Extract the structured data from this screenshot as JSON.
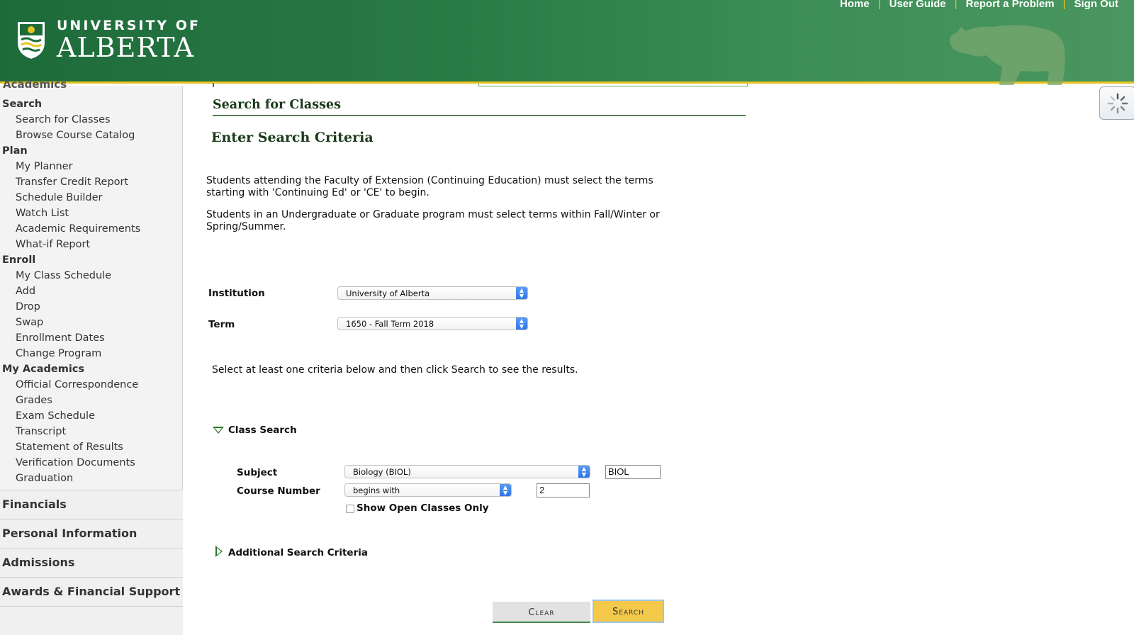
{
  "header": {
    "logo_top": "UNIVERSITY OF",
    "logo_bottom": "ALBERTA",
    "links": [
      "Home",
      "User Guide",
      "Report a Problem",
      "Sign Out"
    ],
    "separator": "|"
  },
  "sidebar": {
    "cut_heading": "Academics",
    "sections": [
      {
        "title": "Search",
        "items": [
          "Search for Classes",
          "Browse Course Catalog"
        ]
      },
      {
        "title": "Plan",
        "items": [
          "My Planner",
          "Transfer Credit Report",
          "Schedule Builder",
          "Watch List",
          "Academic Requirements",
          "What-if Report"
        ]
      },
      {
        "title": "Enroll",
        "items": [
          "My Class Schedule",
          "Add",
          "Drop",
          "Swap",
          "Enrollment Dates",
          "Change Program"
        ]
      },
      {
        "title": "My Academics",
        "items": [
          "Official Correspondence",
          "Grades",
          "Exam Schedule",
          "Transcript",
          "Statement of Results",
          "Verification Documents",
          "Graduation"
        ]
      }
    ],
    "groups": [
      "Financials",
      "Personal Information",
      "Admissions",
      "Awards & Financial Support"
    ]
  },
  "main": {
    "page_title": "Search for Classes",
    "sub_title": "Enter Search Criteria",
    "para1": "Students attending the Faculty of Extension (Continuing Education) must select the terms starting with 'Continuing Ed' or 'CE' to begin.",
    "para2": "Students in an Undergraduate or Graduate program must select terms within Fall/Winter or Spring/Summer.",
    "institution_label": "Institution",
    "institution_value": "University of Alberta",
    "term_label": "Term",
    "term_value": "1650 - Fall Term 2018",
    "instruction": "Select at least one criteria below and then click Search to see the results.",
    "class_search_label": "Class Search",
    "subject_label": "Subject",
    "subject_value": "Biology (BIOL)",
    "subject_code": "BIOL",
    "course_number_label": "Course Number",
    "course_number_operator": "begins with",
    "course_number_value": "2",
    "open_only_label": "Show Open Classes Only",
    "additional_label": "Additional Search Criteria",
    "clear_label": "Clear",
    "search_label": "Search"
  },
  "colors": {
    "header_green": "#2a7a45",
    "accent_gold": "#e8c520",
    "search_button": "#f4c94a"
  }
}
